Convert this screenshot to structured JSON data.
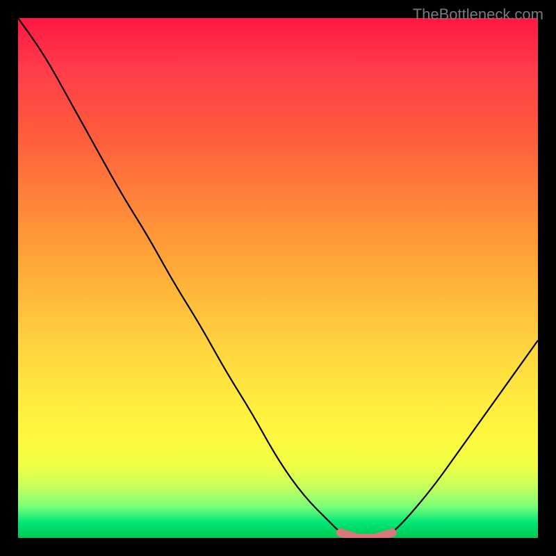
{
  "watermark": "TheBottleneck.com",
  "chart_data": {
    "type": "line",
    "title": "",
    "xlabel": "",
    "ylabel": "",
    "x": [
      0,
      5,
      10,
      15,
      20,
      25,
      30,
      35,
      40,
      45,
      50,
      55,
      60,
      62,
      65,
      68,
      70,
      72,
      75,
      80,
      85,
      90,
      95,
      100
    ],
    "values": [
      100,
      93,
      84,
      75,
      66,
      58,
      49,
      41,
      32,
      24,
      15,
      8,
      3,
      1,
      0,
      0,
      0,
      1,
      4,
      10,
      17,
      24,
      31,
      38
    ],
    "xlim": [
      0,
      100
    ],
    "ylim": [
      0,
      100
    ],
    "grid": false,
    "annotations": [
      {
        "label": "trough-marker",
        "x_range": [
          62,
          72
        ],
        "style": "pink-dashed-segment"
      }
    ],
    "background": "vertical-rainbow-gradient red-top green-bottom",
    "frame": "black-border"
  }
}
